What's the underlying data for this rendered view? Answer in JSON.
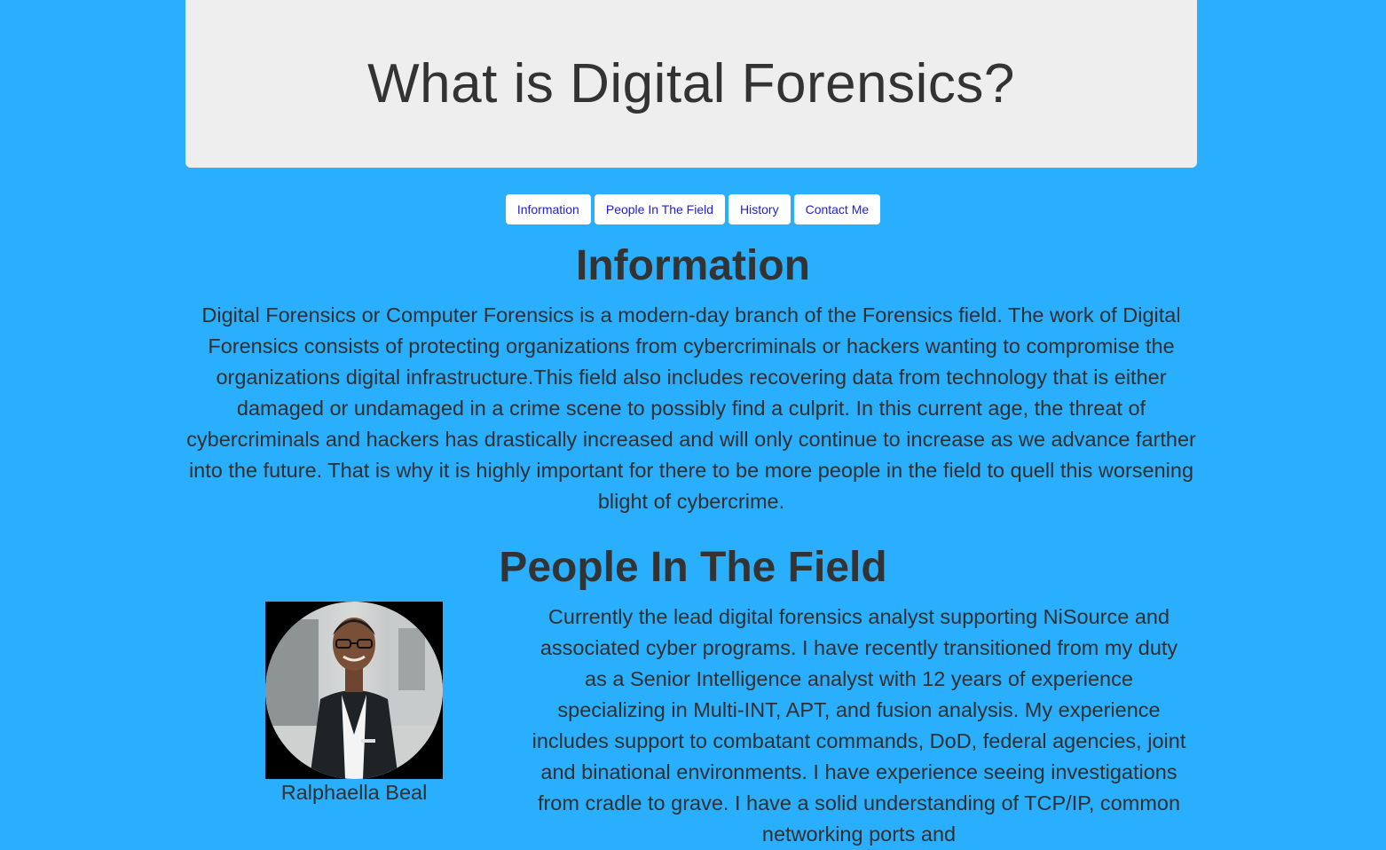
{
  "header": {
    "title": "What is Digital Forensics?"
  },
  "nav": {
    "items": [
      {
        "label": "Information"
      },
      {
        "label": "People In The Field"
      },
      {
        "label": "History"
      },
      {
        "label": "Contact Me"
      }
    ]
  },
  "information": {
    "heading": "Information",
    "body": "Digital Forensics or Computer Forensics is a modern-day branch of the Forensics field. The work of Digital Forensics consists of protecting organizations from cybercriminals or hackers wanting to compromise the organizations digital infrastructure.This field also includes recovering data from technology that is either damaged or undamaged in a crime scene to possibly find a culprit. In this current age, the threat of cybercriminals and hackers has drastically increased and will only continue to increase as we advance farther into the future. That is why it is highly important for there to be more people in the field to quell this worsening blight of cybercrime."
  },
  "people": {
    "heading": "People In The Field",
    "person": {
      "name": "Ralphaella Beal",
      "bio": "Currently the lead digital forensics analyst supporting NiSource and associated cyber programs. I have recently transitioned from my duty as a Senior Intelligence analyst with 12 years of experience specializing in Multi-INT, APT, and fusion analysis. My experience includes support to combatant commands, DoD, federal agencies, joint and binational environments. I have experience seeing investigations from cradle to grave. I have a solid understanding of TCP/IP, common networking ports and"
    }
  },
  "colors": {
    "page_background": "#2aafff",
    "jumbotron_background": "#eeeeee",
    "nav_button_background": "#ffffff",
    "nav_button_text": "#2222cc",
    "text": "#333333"
  }
}
